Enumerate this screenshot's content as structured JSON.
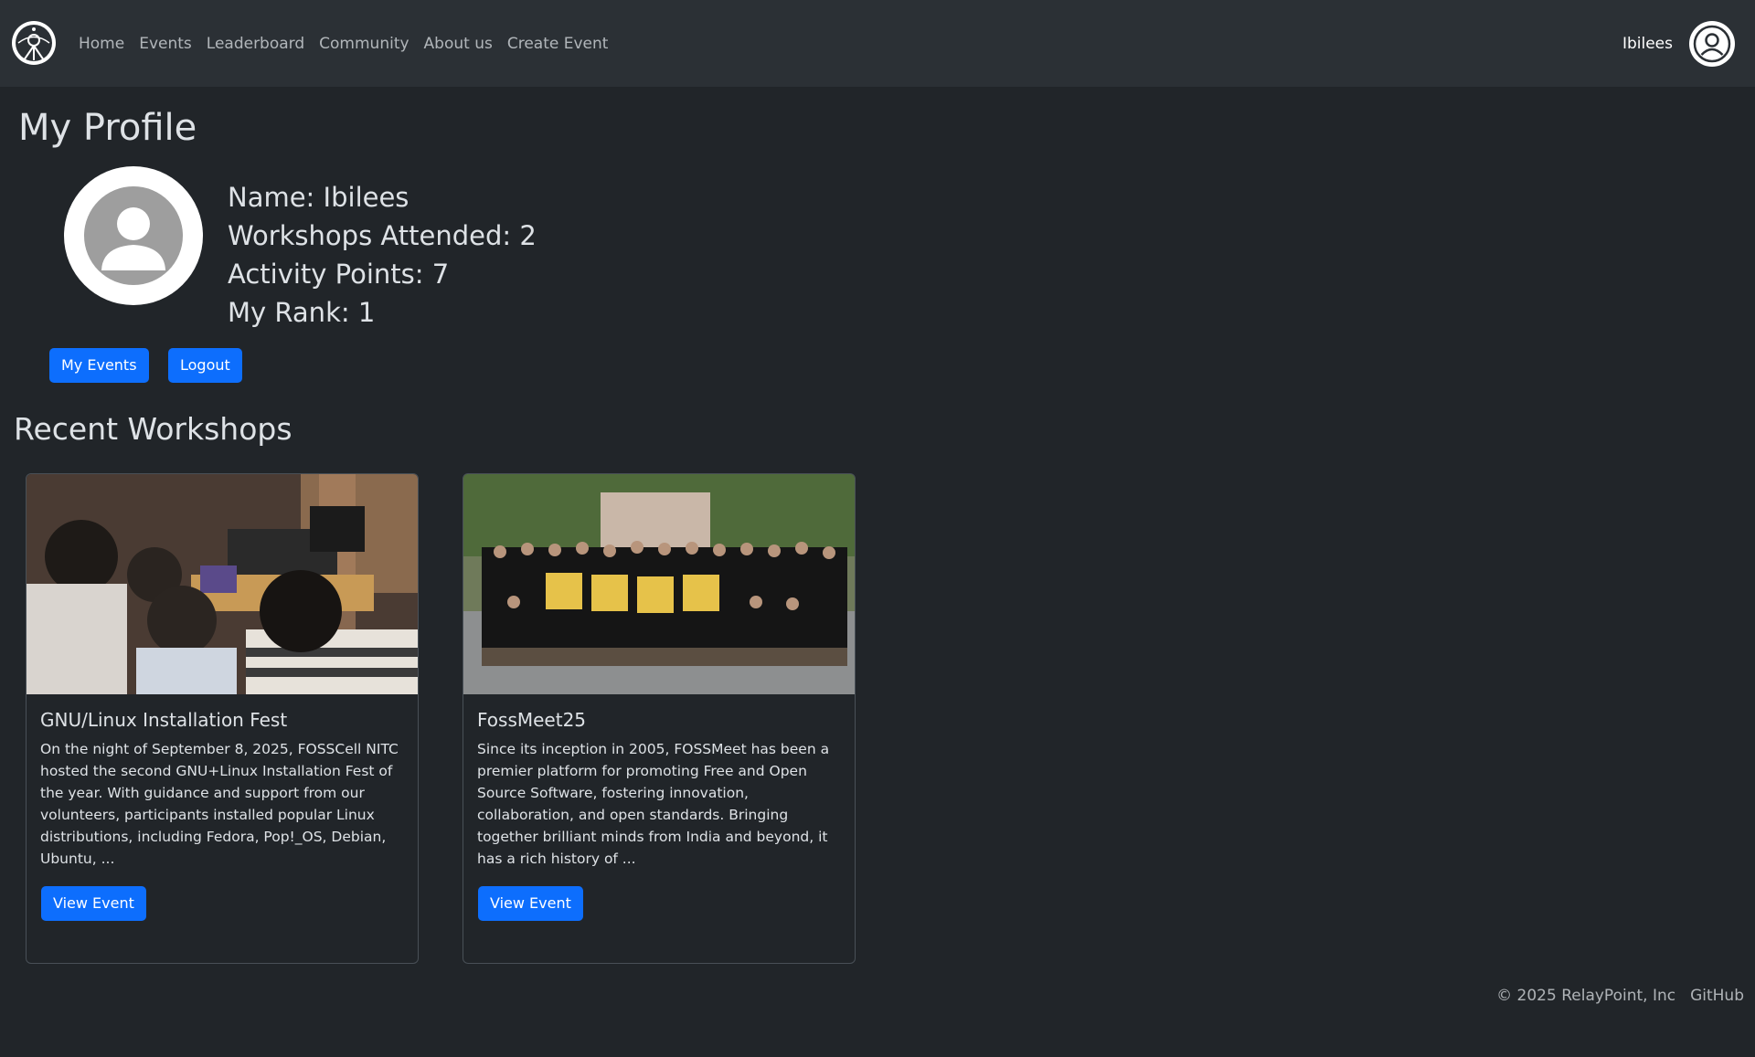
{
  "nav": {
    "links": [
      "Home",
      "Events",
      "Leaderboard",
      "Community",
      "About us",
      "Create Event"
    ],
    "username": "Ibilees"
  },
  "profile": {
    "title": "My Profile",
    "name": "Name: Ibilees",
    "workshops": "Workshops Attended: 2",
    "points": "Activity Points: 7",
    "rank": "My Rank: 1",
    "my_events_label": "My Events",
    "logout_label": "Logout"
  },
  "workshops": {
    "title": "Recent Workshops",
    "cards": [
      {
        "title": "GNU/Linux Installation Fest",
        "text": "On the night of September 8, 2025, FOSSCell NITC hosted the second GNU+Linux Installation Fest of the year. With guidance and support from our volunteers, participants installed popular Linux distributions, including Fedora, Pop!_OS, Debian, Ubuntu, ...",
        "button": "View Event"
      },
      {
        "title": "FossMeet25",
        "text": "Since its inception in 2005, FOSSMeet has been a premier platform for promoting Free and Open Source Software, fostering innovation, collaboration, and open standards. Bringing together brilliant minds from India and beyond, it has a rich history of ...",
        "button": "View Event"
      }
    ]
  },
  "footer": {
    "copyright": "© 2025 RelayPoint, Inc",
    "github": "GitHub"
  },
  "colors": {
    "background": "#212529",
    "navbar": "#2b3035",
    "primary": "#0d6efd"
  }
}
